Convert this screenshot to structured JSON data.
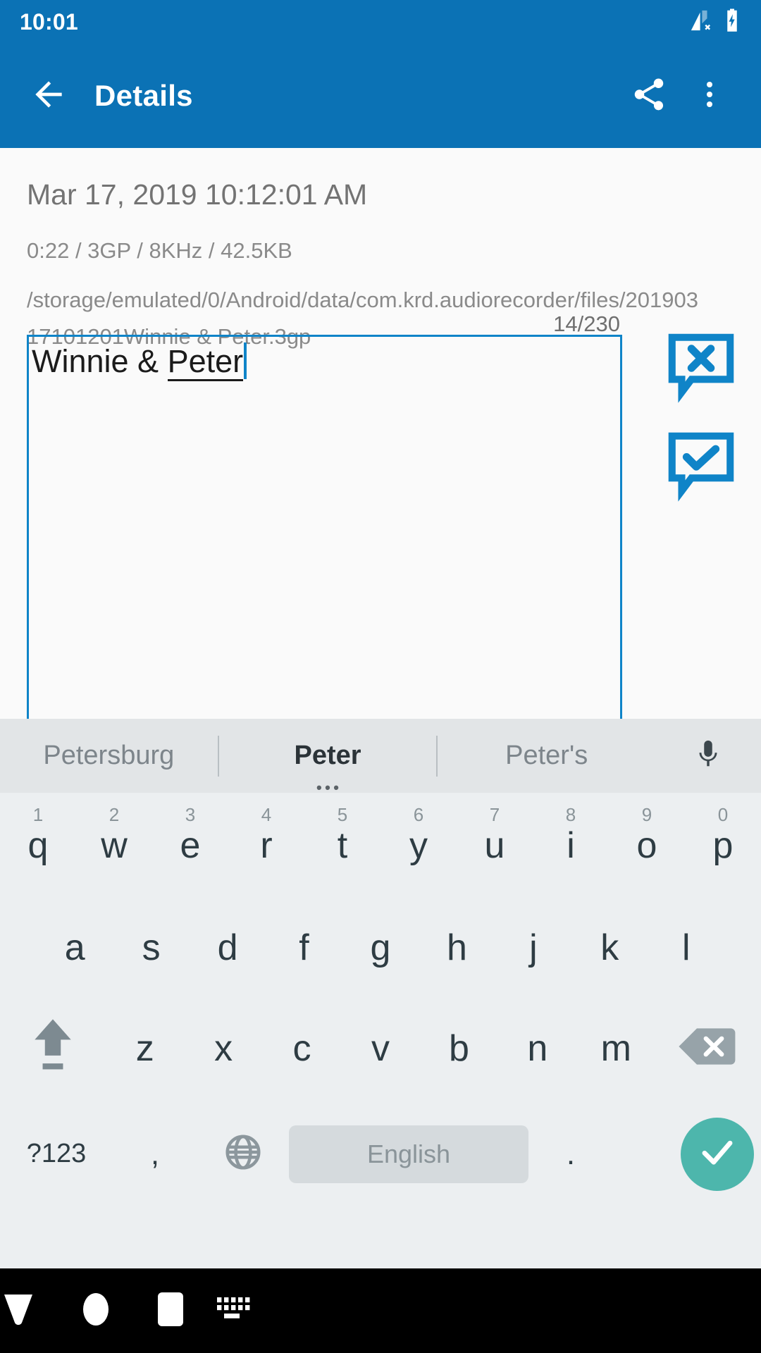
{
  "status_bar": {
    "clock": "10:01",
    "icons": [
      "signal-no-sim-icon",
      "battery-charging-icon"
    ]
  },
  "app_bar": {
    "back_icon": "arrow-back-icon",
    "title": "Details",
    "share_icon": "share-icon",
    "overflow_icon": "more-vert-icon",
    "background_color": "#0b72b5"
  },
  "details": {
    "date": "Mar 17, 2019 10:12:01 AM",
    "meta": "0:22 / 3GP / 8KHz / 42.5KB",
    "path": "/storage/emulated/0/Android/data/com.krd.audiorecorder/files/20190317101201Winnie & Peter.3gp",
    "char_counter": "14/230",
    "rename_field": {
      "value_plain": "Winnie & ",
      "value_composing": "Peter",
      "full_value": "Winnie & Peter",
      "border_color": "#0f84c8",
      "caret_color": "#0f84c8"
    },
    "cancel_button_icon": "comment-cancel-icon",
    "confirm_button_icon": "comment-check-icon",
    "accent_color": "#0f84c8"
  },
  "keyboard": {
    "suggestions": [
      {
        "label": "Petersburg",
        "active": false
      },
      {
        "label": "Peter",
        "active": true
      },
      {
        "label": "Peter's",
        "active": false
      }
    ],
    "mic_icon": "microphone-icon",
    "row1": [
      {
        "letter": "q",
        "num": "1"
      },
      {
        "letter": "w",
        "num": "2"
      },
      {
        "letter": "e",
        "num": "3"
      },
      {
        "letter": "r",
        "num": "4"
      },
      {
        "letter": "t",
        "num": "5"
      },
      {
        "letter": "y",
        "num": "6"
      },
      {
        "letter": "u",
        "num": "7"
      },
      {
        "letter": "i",
        "num": "8"
      },
      {
        "letter": "o",
        "num": "9"
      },
      {
        "letter": "p",
        "num": "0"
      }
    ],
    "row2": [
      {
        "letter": "a"
      },
      {
        "letter": "s"
      },
      {
        "letter": "d"
      },
      {
        "letter": "f"
      },
      {
        "letter": "g"
      },
      {
        "letter": "h"
      },
      {
        "letter": "j"
      },
      {
        "letter": "k"
      },
      {
        "letter": "l"
      }
    ],
    "row3": [
      {
        "letter": "z"
      },
      {
        "letter": "x"
      },
      {
        "letter": "c"
      },
      {
        "letter": "v"
      },
      {
        "letter": "b"
      },
      {
        "letter": "n"
      },
      {
        "letter": "m"
      }
    ],
    "shift_icon": "shift-arrow-up-icon",
    "backspace_icon": "backspace-icon",
    "symbols_label": "?123",
    "comma_label": ",",
    "globe_icon": "language-globe-icon",
    "space_label": "English",
    "period_label": ".",
    "enter_icon": "check-icon",
    "enter_color": "#4db6ac",
    "background_color": "#eceff1",
    "suggestion_bar_color": "#e2e5e7"
  },
  "nav_bar": {
    "back_icon": "keyboard-hide-down-icon",
    "home_icon": "home-circle-icon",
    "recents_icon": "recents-square-icon",
    "keyboard_icon": "keyboard-switcher-icon",
    "background_color": "#000000"
  }
}
